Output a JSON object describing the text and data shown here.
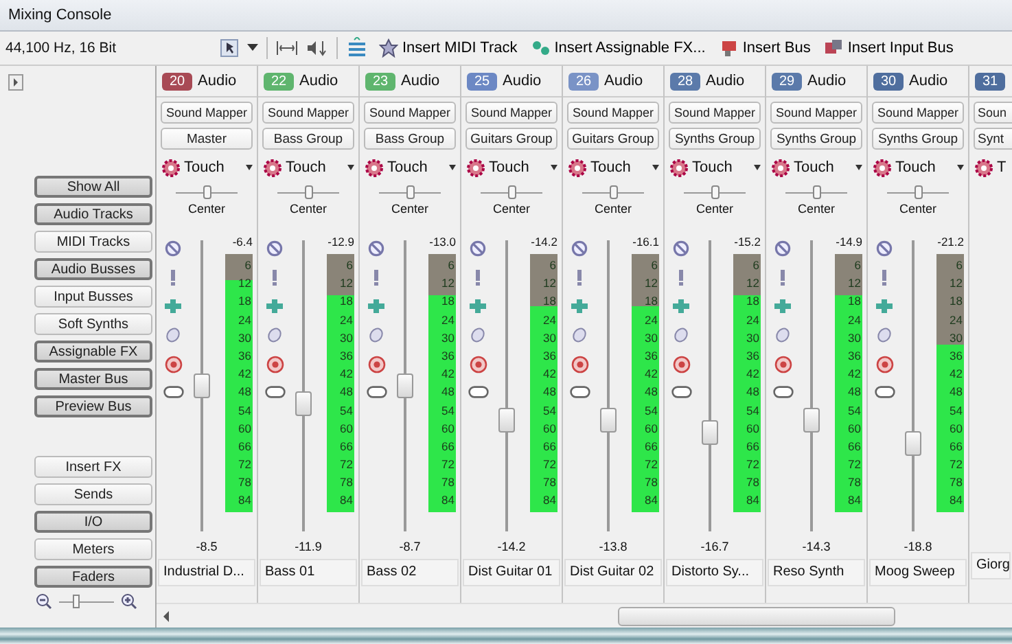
{
  "window": {
    "title": "Mixing Console"
  },
  "toolbar": {
    "format": "44,100 Hz, 16 Bit",
    "buttons": [
      "Insert MIDI Track",
      "Insert Assignable FX...",
      "Insert Bus",
      "Insert Input Bus"
    ]
  },
  "sidebar": {
    "filters": [
      {
        "label": "Show All",
        "selected": true
      },
      {
        "label": "Audio Tracks",
        "selected": true
      },
      {
        "label": "MIDI Tracks",
        "selected": false
      },
      {
        "label": "Audio Busses",
        "selected": true
      },
      {
        "label": "Input Busses",
        "selected": false
      },
      {
        "label": "Soft Synths",
        "selected": false
      },
      {
        "label": "Assignable FX",
        "selected": true
      },
      {
        "label": "Master Bus",
        "selected": true
      },
      {
        "label": "Preview Bus",
        "selected": true
      }
    ],
    "sections": [
      {
        "label": "Insert FX",
        "selected": false
      },
      {
        "label": "Sends",
        "selected": false
      },
      {
        "label": "I/O",
        "selected": true
      },
      {
        "label": "Meters",
        "selected": false
      },
      {
        "label": "Faders",
        "selected": true
      }
    ],
    "zoom": {
      "level": 0.3
    }
  },
  "strips": [
    {
      "number": "20",
      "type": "Audio",
      "color": "#a84a55",
      "input": "Sound Mapper",
      "output": "Master",
      "automation": "Touch",
      "pan": {
        "level": 0.5,
        "label": "Center"
      },
      "peak": "-6.4",
      "meter": {
        "level": 0.9
      },
      "scale": [
        "6",
        "12",
        "18",
        "24",
        "30",
        "36",
        "42",
        "48",
        "54",
        "60",
        "66",
        "72",
        "78",
        "84"
      ],
      "fader": {
        "level": 0.5
      },
      "reading": "-8.5",
      "name": "Industrial D..."
    },
    {
      "number": "22",
      "type": "Audio",
      "color": "#5fb56e",
      "input": "Sound Mapper",
      "output": "Bass Group",
      "automation": "Touch",
      "pan": {
        "level": 0.5,
        "label": "Center"
      },
      "peak": "-12.9",
      "meter": {
        "level": 0.84
      },
      "scale": [
        "6",
        "12",
        "18",
        "24",
        "30",
        "36",
        "42",
        "48",
        "54",
        "60",
        "66",
        "72",
        "78",
        "84"
      ],
      "fader": {
        "level": 0.44
      },
      "reading": "-11.9",
      "name": "Bass 01"
    },
    {
      "number": "23",
      "type": "Audio",
      "color": "#5fb56e",
      "input": "Sound Mapper",
      "output": "Bass Group",
      "automation": "Touch",
      "pan": {
        "level": 0.5,
        "label": "Center"
      },
      "peak": "-13.0",
      "meter": {
        "level": 0.84
      },
      "scale": [
        "6",
        "12",
        "18",
        "24",
        "30",
        "36",
        "42",
        "48",
        "54",
        "60",
        "66",
        "72",
        "78",
        "84"
      ],
      "fader": {
        "level": 0.5
      },
      "reading": "-8.7",
      "name": "Bass 02"
    },
    {
      "number": "25",
      "type": "Audio",
      "color": "#6c88c4",
      "input": "Sound Mapper",
      "output": "Guitars Group",
      "automation": "Touch",
      "pan": {
        "level": 0.5,
        "label": "Center"
      },
      "peak": "-14.2",
      "meter": {
        "level": 0.8
      },
      "scale": [
        "6",
        "12",
        "18",
        "24",
        "30",
        "36",
        "42",
        "48",
        "54",
        "60",
        "66",
        "72",
        "78",
        "84"
      ],
      "fader": {
        "level": 0.38
      },
      "reading": "-14.2",
      "name": "Dist Guitar 01"
    },
    {
      "number": "26",
      "type": "Audio",
      "color": "#7a93c6",
      "input": "Sound Mapper",
      "output": "Guitars Group",
      "automation": "Touch",
      "pan": {
        "level": 0.5,
        "label": "Center"
      },
      "peak": "-16.1",
      "meter": {
        "level": 0.8
      },
      "scale": [
        "6",
        "12",
        "18",
        "24",
        "30",
        "36",
        "42",
        "48",
        "54",
        "60",
        "66",
        "72",
        "78",
        "84"
      ],
      "fader": {
        "level": 0.38
      },
      "reading": "-13.8",
      "name": "Dist Guitar 02"
    },
    {
      "number": "28",
      "type": "Audio",
      "color": "#5b7aaa",
      "input": "Sound Mapper",
      "output": "Synths Group",
      "automation": "Touch",
      "pan": {
        "level": 0.5,
        "label": "Center"
      },
      "peak": "-15.2",
      "meter": {
        "level": 0.84
      },
      "scale": [
        "6",
        "12",
        "18",
        "24",
        "30",
        "36",
        "42",
        "48",
        "54",
        "60",
        "66",
        "72",
        "78",
        "84"
      ],
      "fader": {
        "level": 0.34
      },
      "reading": "-16.7",
      "name": "Distorto Sy..."
    },
    {
      "number": "29",
      "type": "Audio",
      "color": "#5b7aaa",
      "input": "Sound Mapper",
      "output": "Synths Group",
      "automation": "Touch",
      "pan": {
        "level": 0.5,
        "label": "Center"
      },
      "peak": "-14.9",
      "meter": {
        "level": 0.84
      },
      "scale": [
        "6",
        "12",
        "18",
        "24",
        "30",
        "36",
        "42",
        "48",
        "54",
        "60",
        "66",
        "72",
        "78",
        "84"
      ],
      "fader": {
        "level": 0.38
      },
      "reading": "-14.3",
      "name": "Reso Synth"
    },
    {
      "number": "30",
      "type": "Audio",
      "color": "#4f6e9e",
      "input": "Sound Mapper",
      "output": "Synths Group",
      "automation": "Touch",
      "pan": {
        "level": 0.5,
        "label": "Center"
      },
      "peak": "-21.2",
      "meter": {
        "level": 0.65
      },
      "scale": [
        "6",
        "12",
        "18",
        "24",
        "30",
        "36",
        "42",
        "48",
        "54",
        "60",
        "66",
        "72",
        "78",
        "84"
      ],
      "fader": {
        "level": 0.3
      },
      "reading": "-18.8",
      "name": "Moog Sweep"
    },
    {
      "number": "31",
      "color": "#4f6e9e",
      "input": "Soun",
      "output": "Synt",
      "automation": "T",
      "name": "Giorg"
    }
  ]
}
